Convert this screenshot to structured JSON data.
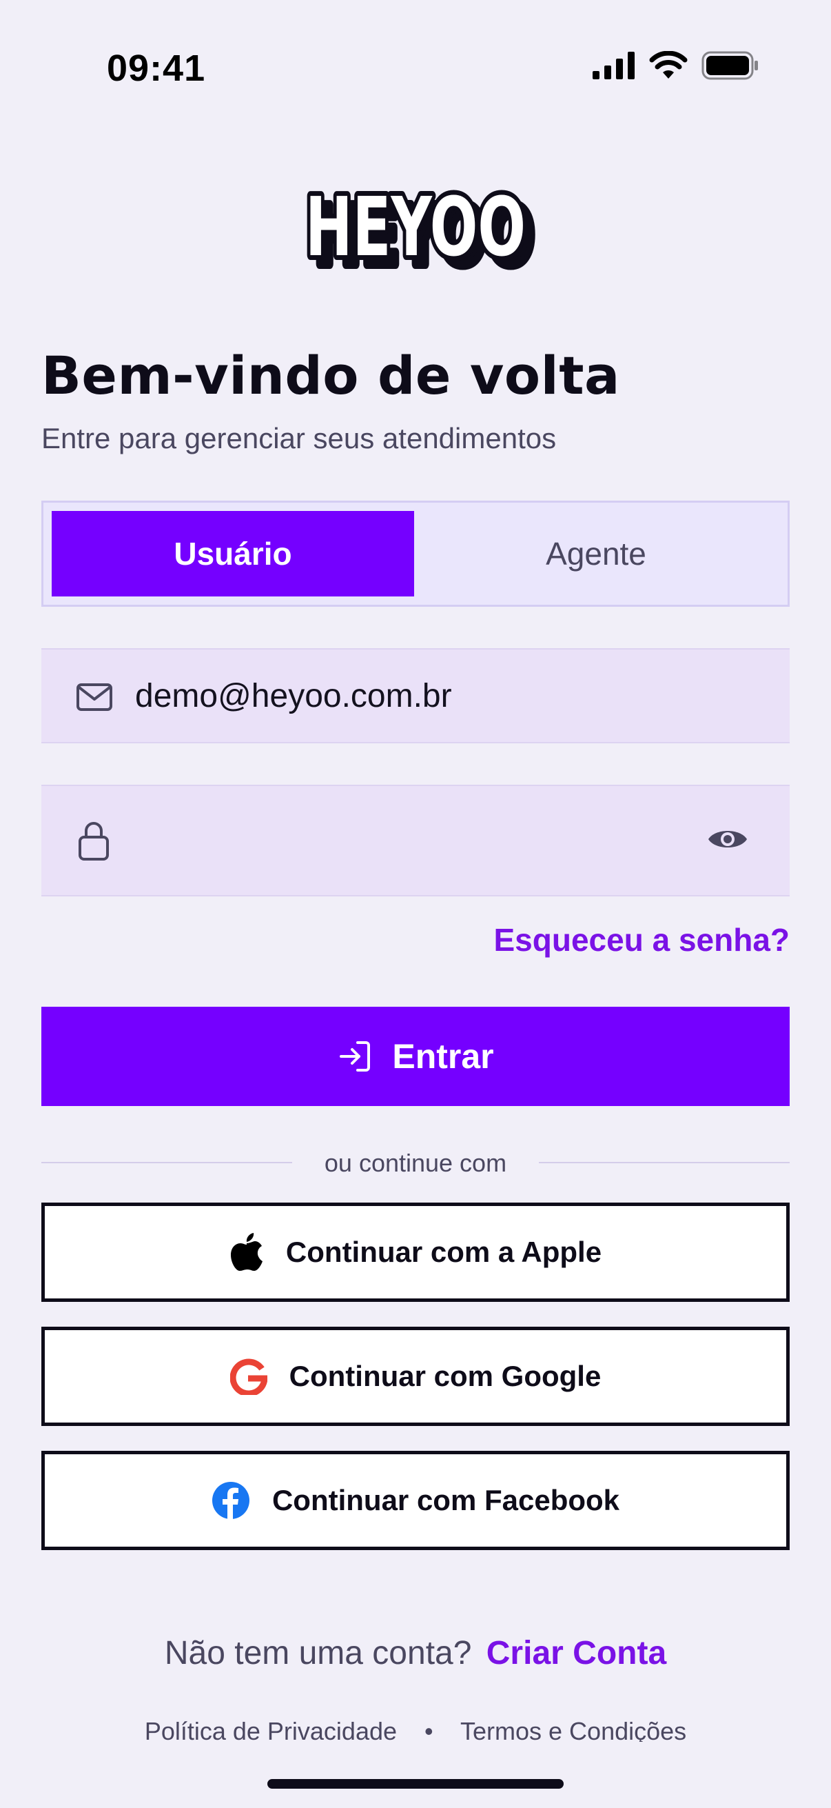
{
  "status_bar": {
    "time": "09:41"
  },
  "logo": {
    "text": "HEYOO"
  },
  "header": {
    "title": "Bem-vindo de volta",
    "subtitle": "Entre para gerenciar seus atendimentos"
  },
  "tabs": [
    {
      "label": "Usuário",
      "active": true
    },
    {
      "label": "Agente",
      "active": false
    }
  ],
  "form": {
    "email_value": "demo@heyoo.com.br",
    "password_value": "",
    "forgot_label": "Esqueceu a senha?",
    "submit_label": "Entrar"
  },
  "divider_label": "ou continue com",
  "social": {
    "apple": "Continuar com a Apple",
    "google": "Continuar com Google",
    "facebook": "Continuar com Facebook"
  },
  "footer": {
    "no_account": "Não tem uma conta?",
    "create_account": "Criar Conta",
    "privacy": "Política de Privacidade",
    "separator": "•",
    "terms": "Termos e Condições"
  },
  "colors": {
    "brand": "#7500FF",
    "link": "#7A12E6",
    "background": "#F1EFF8",
    "input_bg": "#EAE1F8"
  },
  "icons": [
    "signal-icon",
    "wifi-icon",
    "battery-icon",
    "mail-icon",
    "lock-icon",
    "eye-icon",
    "login-icon",
    "apple-icon",
    "google-icon",
    "facebook-icon"
  ]
}
